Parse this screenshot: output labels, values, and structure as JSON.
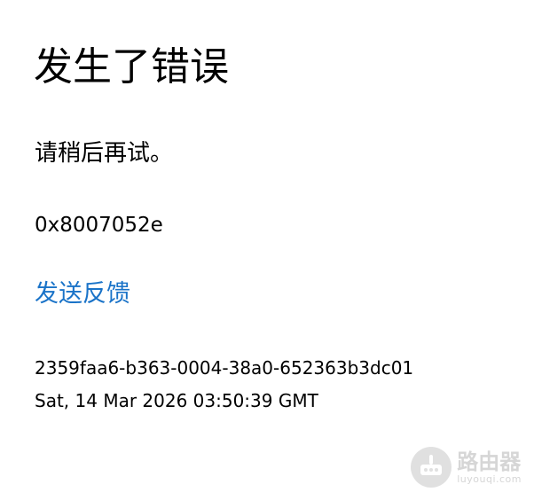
{
  "error_page": {
    "title": "发生了错误",
    "message": "请稍后再试。",
    "error_code": "0x8007052e",
    "feedback_link": "发送反馈",
    "correlation_id": "2359faa6-b363-0004-38a0-652363b3dc01",
    "timestamp": "Sat, 14 Mar 2026 03:50:39 GMT"
  },
  "watermark": {
    "name": "路由器",
    "domain": "luyouqi.com",
    "icon": "router-icon"
  },
  "colors": {
    "link": "#1a73c8",
    "text": "#000000",
    "background": "#ffffff",
    "watermark": "#b5b5b5"
  }
}
